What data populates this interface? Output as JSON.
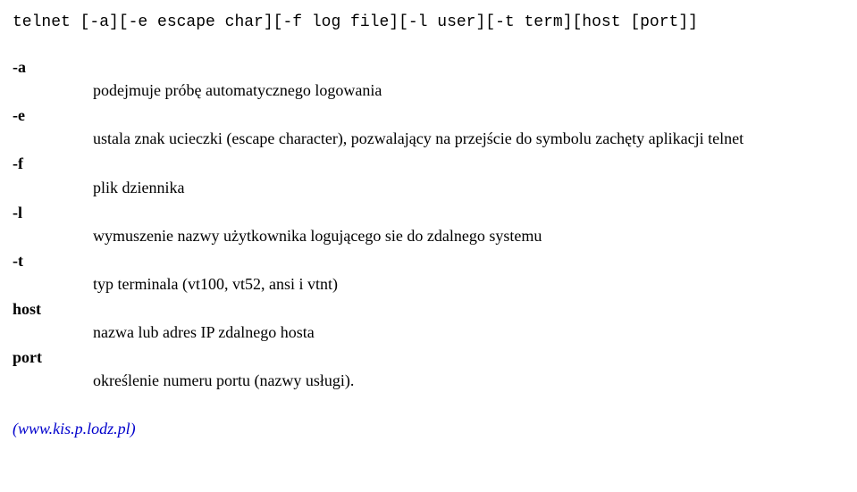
{
  "synopsis": "telnet [-a][-e escape char][-f log file][-l user][-t term][host [port]]",
  "options": {
    "a": {
      "flag": "-a",
      "desc": "podejmuje próbę automatycznego logowania"
    },
    "e": {
      "flag": "-e",
      "desc": "ustala znak ucieczki (escape character), pozwalający na przejście do symbolu zachęty aplikacji telnet"
    },
    "f": {
      "flag": "-f",
      "desc": "plik dziennika"
    },
    "l": {
      "flag": "-l",
      "desc": "wymuszenie nazwy użytkownika logującego sie do zdalnego systemu"
    },
    "t": {
      "flag": "-t",
      "desc": "typ terminala (vt100, vt52, ansi i vtnt)"
    },
    "host": {
      "flag": "host",
      "desc": "nazwa lub adres IP zdalnego hosta"
    },
    "port": {
      "flag": "port",
      "desc": "określenie numeru portu (nazwy usługi)."
    }
  },
  "footer": "(www.kis.p.lodz.pl)"
}
